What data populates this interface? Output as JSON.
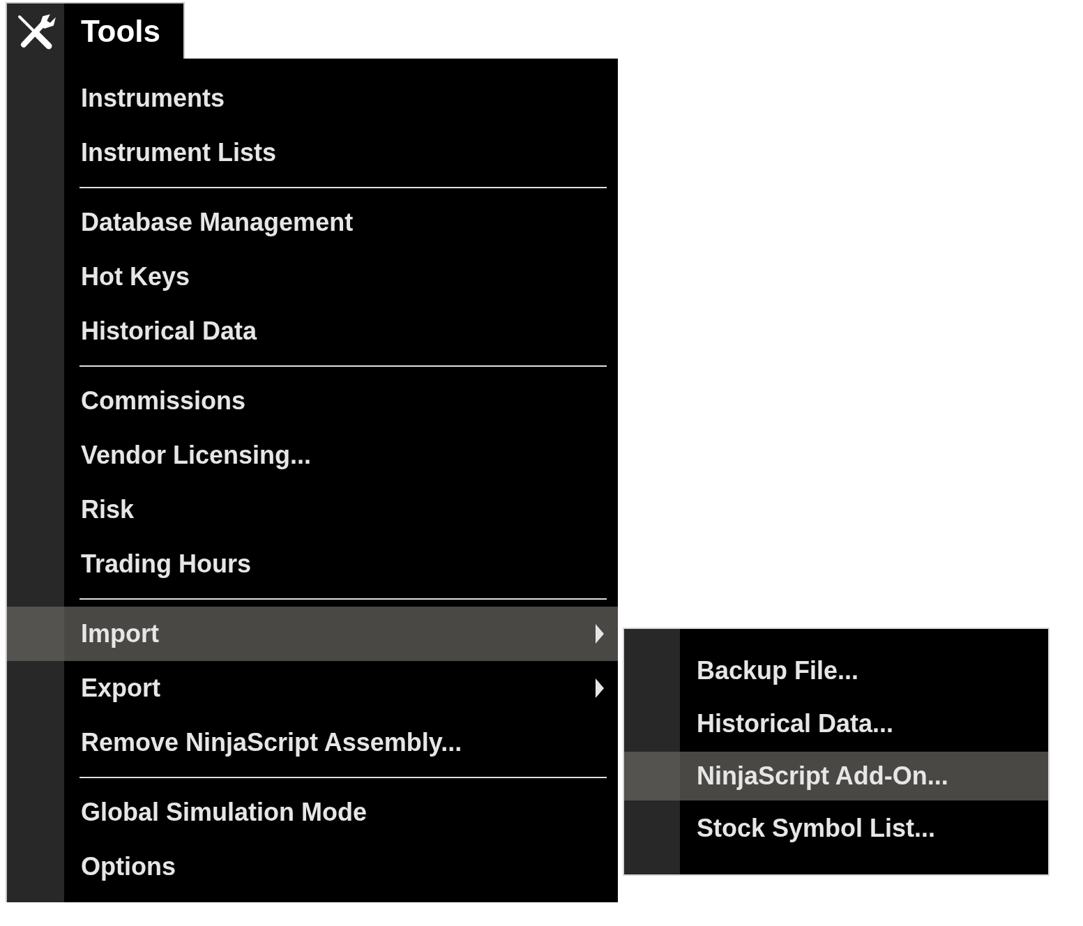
{
  "menu": {
    "title": "Tools",
    "items": [
      {
        "kind": "item",
        "label": "Instruments",
        "selected": false,
        "has_submenu": false
      },
      {
        "kind": "item",
        "label": "Instrument Lists",
        "selected": false,
        "has_submenu": false
      },
      {
        "kind": "separator"
      },
      {
        "kind": "item",
        "label": "Database Management",
        "selected": false,
        "has_submenu": false
      },
      {
        "kind": "item",
        "label": "Hot Keys",
        "selected": false,
        "has_submenu": false
      },
      {
        "kind": "item",
        "label": "Historical Data",
        "selected": false,
        "has_submenu": false
      },
      {
        "kind": "separator"
      },
      {
        "kind": "item",
        "label": "Commissions",
        "selected": false,
        "has_submenu": false
      },
      {
        "kind": "item",
        "label": "Vendor Licensing...",
        "selected": false,
        "has_submenu": false
      },
      {
        "kind": "item",
        "label": "Risk",
        "selected": false,
        "has_submenu": false
      },
      {
        "kind": "item",
        "label": "Trading Hours",
        "selected": false,
        "has_submenu": false
      },
      {
        "kind": "separator"
      },
      {
        "kind": "item",
        "label": "Import",
        "selected": true,
        "has_submenu": true
      },
      {
        "kind": "item",
        "label": "Export",
        "selected": false,
        "has_submenu": true
      },
      {
        "kind": "item",
        "label": "Remove NinjaScript Assembly...",
        "selected": false,
        "has_submenu": false
      },
      {
        "kind": "separator"
      },
      {
        "kind": "item",
        "label": "Global Simulation Mode",
        "selected": false,
        "has_submenu": false
      },
      {
        "kind": "item",
        "label": "Options",
        "selected": false,
        "has_submenu": false
      }
    ]
  },
  "submenu": {
    "items": [
      {
        "label": "Backup File...",
        "selected": false
      },
      {
        "label": "Historical Data...",
        "selected": false
      },
      {
        "label": "NinjaScript Add-On...",
        "selected": true
      },
      {
        "label": "Stock Symbol List...",
        "selected": false
      }
    ]
  }
}
